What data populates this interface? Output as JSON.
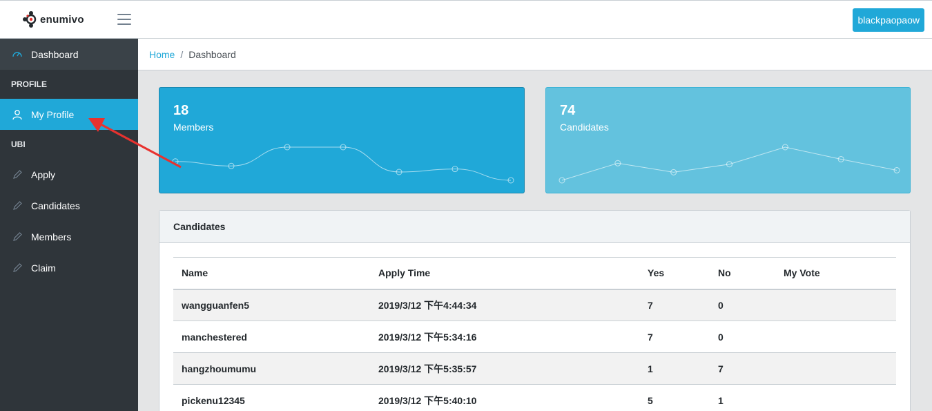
{
  "header": {
    "brand_name": "enumivo",
    "user_button": "blackpaopaow"
  },
  "sidebar": {
    "dashboard": "Dashboard",
    "section_profile": "PROFILE",
    "my_profile": "My Profile",
    "section_ubi": "UBI",
    "items": [
      {
        "label": "Apply"
      },
      {
        "label": "Candidates"
      },
      {
        "label": "Members"
      },
      {
        "label": "Claim"
      }
    ]
  },
  "breadcrumb": {
    "home": "Home",
    "separator": "/",
    "current": "Dashboard"
  },
  "stats": {
    "members": {
      "value": "18",
      "label": "Members",
      "trend": [
        65,
        59,
        84,
        84,
        51,
        55,
        40
      ]
    },
    "candidates": {
      "value": "74",
      "label": "Candidates",
      "trend": [
        1,
        18,
        9,
        17,
        34,
        22,
        11
      ]
    }
  },
  "candidates_card": {
    "title": "Candidates",
    "columns": [
      "Name",
      "Apply Time",
      "Yes",
      "No",
      "My Vote"
    ],
    "rows": [
      [
        "wangguanfen5",
        "2019/3/12 下午4:44:34",
        "7",
        "0",
        ""
      ],
      [
        "manchestered",
        "2019/3/12 下午5:34:16",
        "7",
        "0",
        ""
      ],
      [
        "hangzhoumumu",
        "2019/3/12 下午5:35:57",
        "1",
        "7",
        ""
      ],
      [
        "pickenu12345",
        "2019/3/12 下午5:40:10",
        "5",
        "1",
        ""
      ]
    ]
  },
  "colors": {
    "primary": "#20a8d8",
    "info": "#63c2de",
    "sidebar_bg": "#2f353a",
    "annotation_arrow": "#e8322f"
  }
}
